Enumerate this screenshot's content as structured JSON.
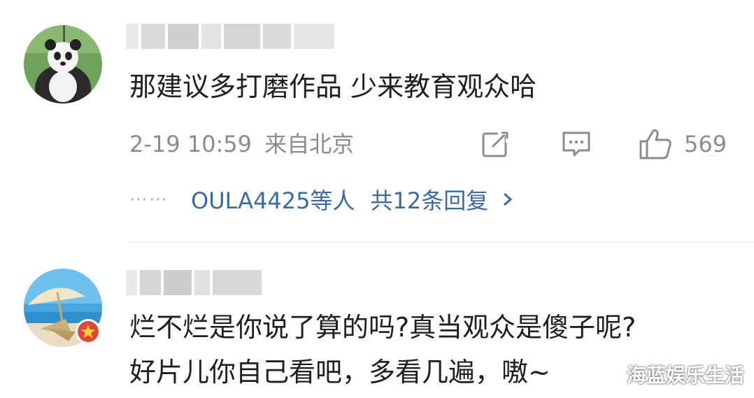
{
  "comments": [
    {
      "content": "那建议多打磨作品 少来教育观众哈",
      "time": "2-19 10:59",
      "location": "来自北京",
      "like_count": "569",
      "reply_users": "OULA4425等人",
      "reply_count_link": "共12条回复",
      "reply_dots": "⋯⋯"
    },
    {
      "content_line1": "烂不烂是你说了算的吗?真当观众是傻子呢?",
      "content_line2": "好片儿你自己看吧，多看几遍，嗷~"
    }
  ],
  "watermark": "海蓝娱乐生活",
  "colors": {
    "link": "#3d6a9e",
    "meta": "#8c8c8c",
    "text": "#1f1f1f",
    "badge": "#e2473a"
  },
  "icons": [
    "repost-icon",
    "comment-icon",
    "like-icon",
    "chevron-right-icon",
    "verified-badge-icon"
  ]
}
